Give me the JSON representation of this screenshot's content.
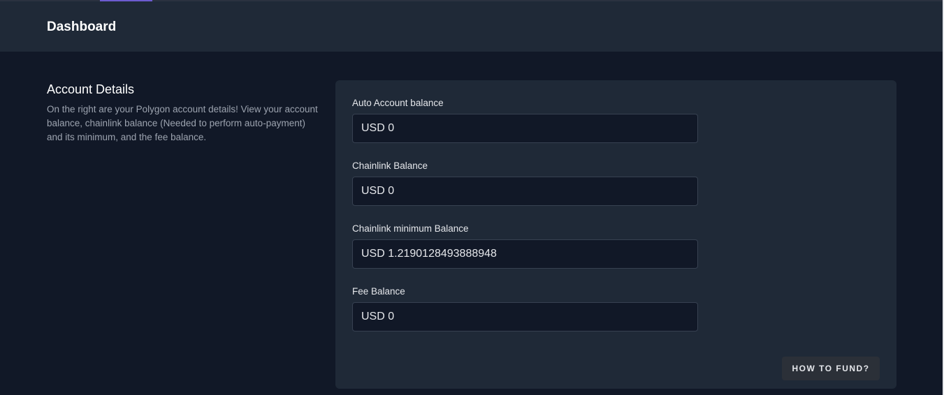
{
  "header": {
    "title": "Dashboard"
  },
  "account_section": {
    "title": "Account Details",
    "description": "On the right are your Polygon account details! View your account balance, chainlink balance (Needed to perform auto-payment) and its minimum, and the fee balance."
  },
  "fields": [
    {
      "label": "Auto Account balance",
      "value": "USD 0"
    },
    {
      "label": "Chainlink Balance",
      "value": "USD 0"
    },
    {
      "label": "Chainlink minimum Balance",
      "value": "USD 1.2190128493888948"
    },
    {
      "label": "Fee Balance",
      "value": "USD 0"
    }
  ],
  "actions": {
    "fund_label": "HOW TO FUND?"
  },
  "colors": {
    "page_background": "#111827",
    "panel_background": "#1f2937",
    "input_background": "#111827",
    "accent": "#6d5bd0"
  }
}
